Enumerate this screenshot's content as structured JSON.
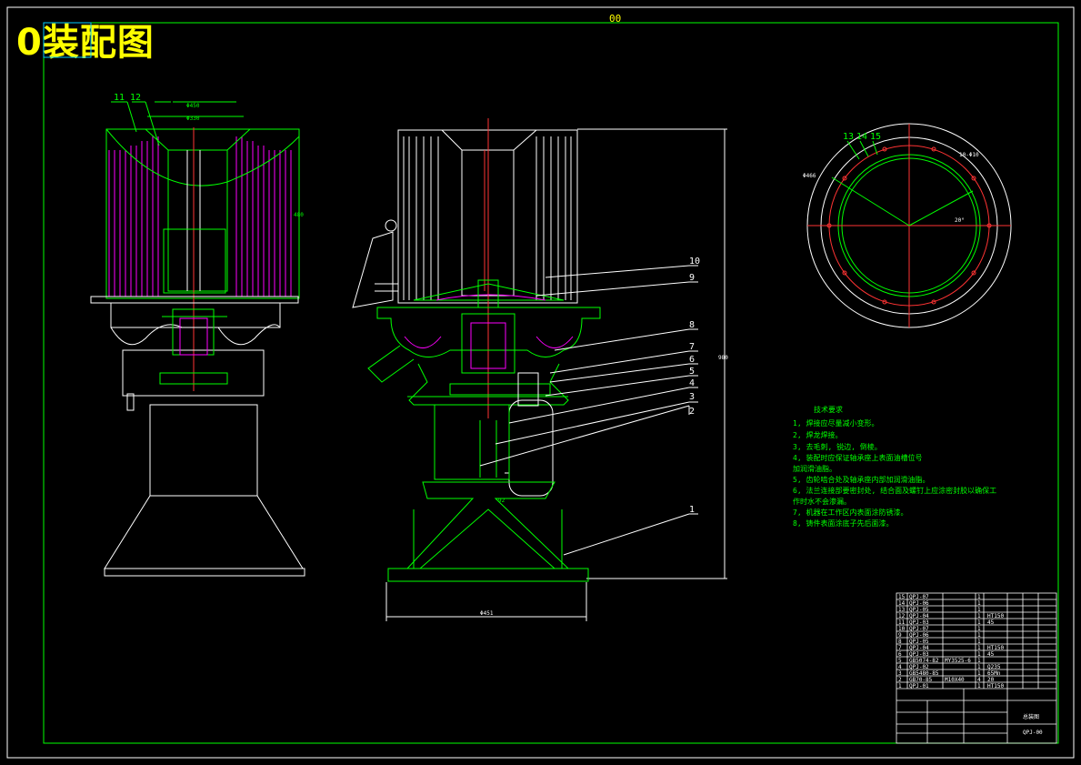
{
  "title": "0装配图",
  "sheet_code": "00",
  "part_callouts": [
    "1",
    "2",
    "3",
    "4",
    "5",
    "6",
    "7",
    "8",
    "9",
    "10",
    "11",
    "12",
    "13",
    "14",
    "15"
  ],
  "tech_requirements": {
    "heading": "技术要求",
    "items": [
      "1, 焊接应尽量减小变形。",
      "2, 焊龙焊接。",
      "3, 去毛刺, 锐边, 倒棱。",
      "4, 装配时应保证轴承座上表面油槽位号",
      "加润滑油脂。",
      "5, 齿轮啮合处及轴承座内部加润滑油脂。",
      "6, 法兰连接部要密封处, 结合面及螺钉上应涂密封胶以确保工",
      "作时水不会渗漏。",
      "7, 机器在工作区内表面涂防锈漆。",
      "8, 铸件表面涂底子先后面漆。"
    ]
  },
  "bom": {
    "rows": [
      {
        "no": "15",
        "code": "QPJ-07",
        "name": "",
        "qty": "1",
        "material": ""
      },
      {
        "no": "14",
        "code": "QPJ-06",
        "name": "",
        "qty": "1",
        "material": ""
      },
      {
        "no": "13",
        "code": "QPJ-05",
        "name": "",
        "qty": "1",
        "material": ""
      },
      {
        "no": "12",
        "code": "QPJ-04",
        "name": "",
        "qty": "1",
        "material": "HT150"
      },
      {
        "no": "11",
        "code": "QPJ-03",
        "name": "",
        "qty": "1",
        "material": "45"
      },
      {
        "no": "10",
        "code": "QPJ-07",
        "name": "",
        "qty": "1",
        "material": ""
      },
      {
        "no": "9",
        "code": "QPJ-06",
        "name": "",
        "qty": "1",
        "material": ""
      },
      {
        "no": "8",
        "code": "QPJ-05",
        "name": "",
        "qty": "1",
        "material": ""
      },
      {
        "no": "7",
        "code": "QPJ-04",
        "name": "",
        "qty": "1",
        "material": "HT150"
      },
      {
        "no": "6",
        "code": "QPJ-03",
        "name": "",
        "qty": "1",
        "material": "45"
      },
      {
        "no": "5",
        "code": "GB5074-82",
        "name": "MY3525-6",
        "qty": "1",
        "material": ""
      },
      {
        "no": "4",
        "code": "QPJ-02",
        "name": "",
        "qty": "1",
        "material": "Q235"
      },
      {
        "no": "3",
        "code": "GB5480-85",
        "name": "",
        "qty": "1",
        "material": "65Mn"
      },
      {
        "no": "2",
        "code": "GB70-85",
        "name": "M10X40",
        "qty": "4",
        "material": "20"
      },
      {
        "no": "1",
        "code": "QPJ-01",
        "name": "",
        "qty": "1",
        "material": "HT150"
      }
    ],
    "title_block": {
      "drawing_name": "总装图",
      "company": "",
      "drawing_no": "QPJ-00"
    }
  }
}
